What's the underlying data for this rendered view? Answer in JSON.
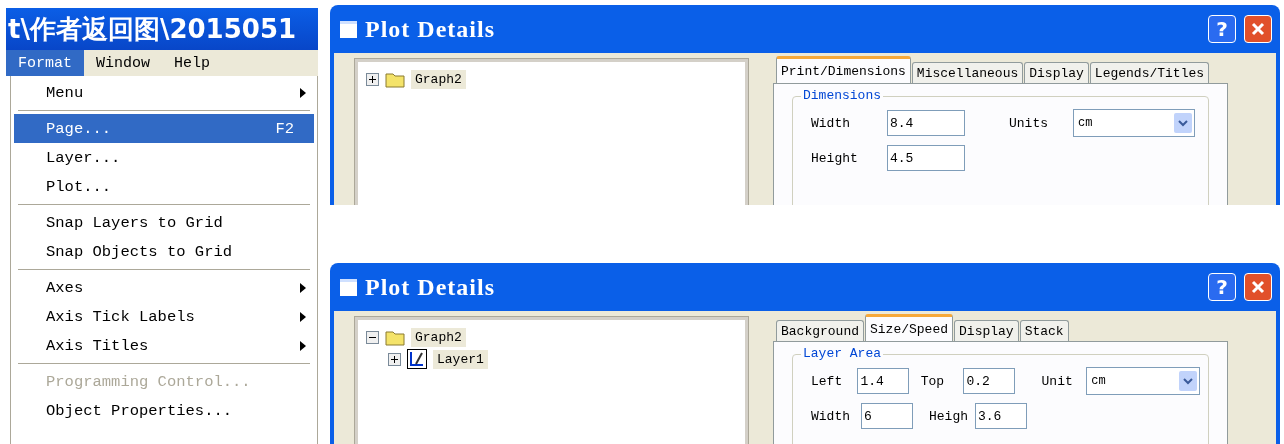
{
  "app_window": {
    "title": "t\\作者返回图\\2015051"
  },
  "menu_bar": [
    {
      "label": "Format",
      "selected": true
    },
    {
      "label": "Window",
      "selected": false
    },
    {
      "label": "Help",
      "selected": false
    }
  ],
  "format_menu": [
    {
      "kind": "item",
      "label": "Menu",
      "submenu": true,
      "selected": false,
      "disabled": false
    },
    {
      "kind": "separator"
    },
    {
      "kind": "item",
      "label": "Page...",
      "shortcut": "F2",
      "submenu": false,
      "selected": true,
      "disabled": false
    },
    {
      "kind": "item",
      "label": "Layer...",
      "submenu": false,
      "selected": false,
      "disabled": false
    },
    {
      "kind": "item",
      "label": "Plot...",
      "submenu": false,
      "selected": false,
      "disabled": false
    },
    {
      "kind": "separator"
    },
    {
      "kind": "item",
      "label": "Snap Layers to Grid",
      "submenu": false,
      "selected": false,
      "disabled": false
    },
    {
      "kind": "item",
      "label": "Snap Objects to Grid",
      "submenu": false,
      "selected": false,
      "disabled": false
    },
    {
      "kind": "separator"
    },
    {
      "kind": "item",
      "label": "Axes",
      "submenu": true,
      "selected": false,
      "disabled": false
    },
    {
      "kind": "item",
      "label": "Axis Tick Labels",
      "submenu": true,
      "selected": false,
      "disabled": false
    },
    {
      "kind": "item",
      "label": "Axis Titles",
      "submenu": true,
      "selected": false,
      "disabled": false
    },
    {
      "kind": "separator"
    },
    {
      "kind": "item",
      "label": "Programming Control...",
      "submenu": false,
      "selected": false,
      "disabled": true
    },
    {
      "kind": "item",
      "label": "Object Properties...",
      "submenu": false,
      "selected": false,
      "disabled": false
    }
  ],
  "dialogs": [
    {
      "title": "Plot Details",
      "help_button": "?",
      "tree": [
        {
          "kind": "graph",
          "label": "Graph2",
          "expanded": false
        }
      ],
      "tabs": [
        {
          "label": "Print/Dimensions",
          "selected": true
        },
        {
          "label": "Miscellaneous",
          "selected": false
        },
        {
          "label": "Display",
          "selected": false
        },
        {
          "label": "Legends/Titles",
          "selected": false
        }
      ],
      "group": {
        "title": "Dimensions",
        "fields": [
          {
            "kind": "text",
            "label": "Width",
            "value": "8.4"
          },
          {
            "kind": "select",
            "label": "Units",
            "value": "cm"
          },
          {
            "kind": "text",
            "label": "Height",
            "value": "4.5"
          }
        ]
      }
    },
    {
      "title": "Plot Details",
      "help_button": "?",
      "tree": [
        {
          "kind": "graph",
          "label": "Graph2",
          "expanded": true,
          "children": [
            {
              "kind": "layer",
              "label": "Layer1",
              "expanded": false
            }
          ]
        }
      ],
      "tabs": [
        {
          "label": "Background",
          "selected": false
        },
        {
          "label": "Size/Speed",
          "selected": true
        },
        {
          "label": "Display",
          "selected": false
        },
        {
          "label": "Stack",
          "selected": false
        }
      ],
      "group": {
        "title": "Layer Area",
        "fields": [
          {
            "kind": "text",
            "label": "Left",
            "value": "1.4"
          },
          {
            "kind": "text",
            "label": "Top",
            "value": "0.2"
          },
          {
            "kind": "select",
            "label": "Unit",
            "value": "cm"
          },
          {
            "kind": "text",
            "label": "Width",
            "value": "6"
          },
          {
            "kind": "text",
            "label": "Heigh",
            "value": "3.6"
          }
        ]
      }
    }
  ]
}
